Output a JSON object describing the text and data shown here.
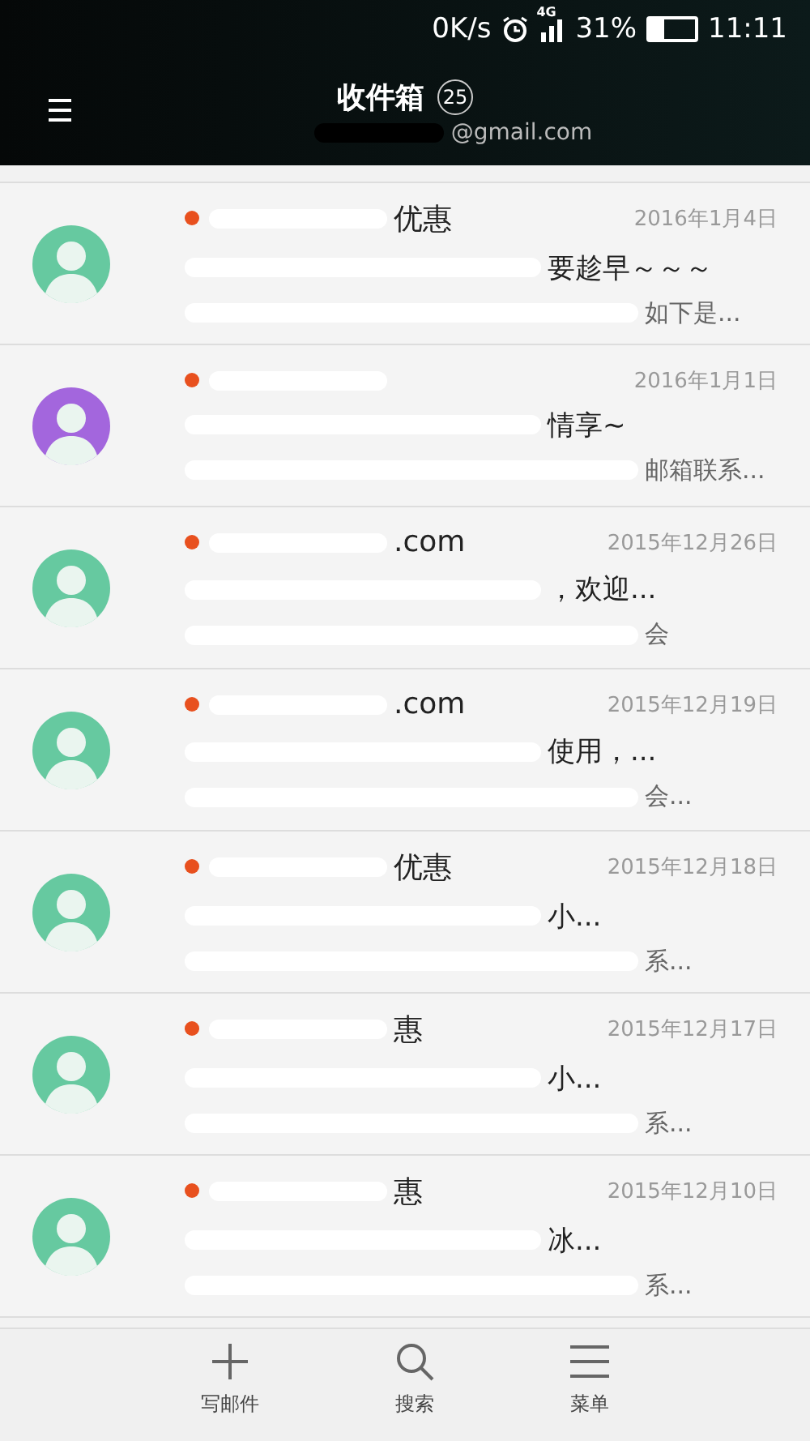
{
  "status_bar": {
    "speed": "0K/s",
    "network": "4G",
    "battery": "31%",
    "time": "11:11"
  },
  "header": {
    "title": "收件箱",
    "count": "25",
    "account": "@gmail.com"
  },
  "messages": [
    {
      "color": "#66c9a0",
      "unread": true,
      "sender": "优惠",
      "date": "2016年1月4日",
      "subject": "要趁早～～～",
      "preview": "如下是..."
    },
    {
      "color": "#a366dd",
      "unread": true,
      "date": "2016年1月1日",
      "subject": "情享~",
      "preview": "邮箱联系..."
    },
    {
      "color": "#66c9a0",
      "unread": true,
      "sender": ".com",
      "date": "2015年12月26日",
      "subject": "，欢迎...",
      "preview": "会"
    },
    {
      "color": "#66c9a0",
      "unread": true,
      "sender": ".com",
      "date": "2015年12月19日",
      "subject": "使用，...",
      "preview": "会..."
    },
    {
      "color": "#66c9a0",
      "unread": true,
      "sender": "优惠",
      "date": "2015年12月18日",
      "subject": "小...",
      "preview": "系..."
    },
    {
      "color": "#66c9a0",
      "unread": true,
      "sender": "惠",
      "date": "2015年12月17日",
      "subject": "小...",
      "preview": "系..."
    },
    {
      "color": "#66c9a0",
      "unread": true,
      "sender": "惠",
      "date": "2015年12月10日",
      "subject": "冰...",
      "preview": "系..."
    }
  ],
  "bottom_bar": [
    {
      "kind": "compose",
      "label": "写邮件"
    },
    {
      "kind": "search",
      "label": "搜索"
    },
    {
      "kind": "menu",
      "label": "菜单"
    }
  ]
}
